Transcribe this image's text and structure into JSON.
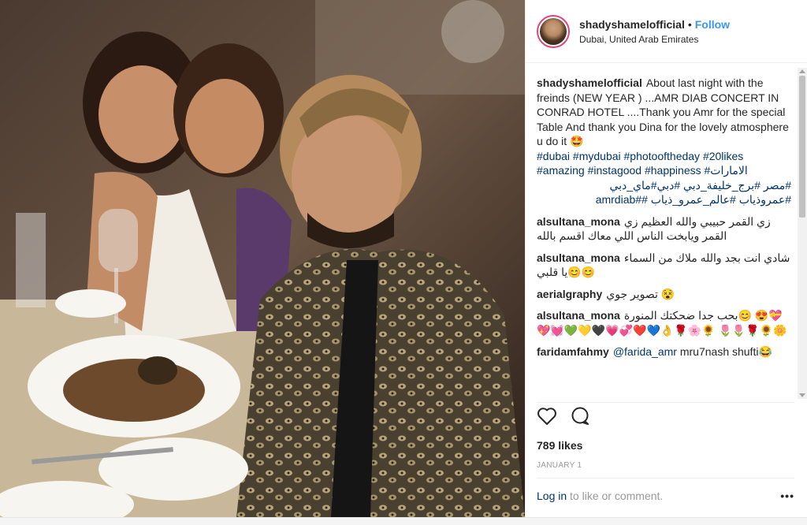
{
  "post": {
    "username": "shadyshamelofficial",
    "separator": "•",
    "follow_label": "Follow",
    "location": "Dubai, United Arab Emirates",
    "caption": {
      "text": "About last night with the freinds (NEW YEAR ) ...AMR DIAB CONCERT IN CONRAD HOTEL ....Thank you Amr for the special Table And thank you Dina for the lovely atmosphere u do it 🤩",
      "hashtags_line1": "#dubai #mydubai #photooftheday #20likes",
      "hashtags_line2": "#amazing #instagood #happiness #الامارات",
      "hashtags_line3": "#مصر #برج_خليفة_دبي #دبي#ماي_دبي",
      "hashtags_line4": "#عمروذياب #عالم_عمرو_ذياب ##amrdiab"
    },
    "comments": [
      {
        "user": "alsultana_mona",
        "text": "زي القمر حبيبي والله العظيم زي القمر ويابخت الناس اللي معاك اقسم بالله"
      },
      {
        "user": "alsultana_mona",
        "text": "شادي انت بجد والله ملاك من السماء يا قلبي😊😊"
      },
      {
        "user": "aerialgraphy",
        "text": "تصوير جوي 😵"
      },
      {
        "user": "alsultana_mona",
        "text": "بحب جدا ضحكتك المنورة😊 😍💝💖💓💚💛🖤💗💞❤️💙👌🌹🌸🌻 🌷🌷🌹🌻🌼"
      },
      {
        "user": "faridamfahmy",
        "mention": "@farida_amr",
        "text": "mru7nash shufti😂"
      }
    ],
    "likes": "789 likes",
    "date": "JANUARY 1",
    "login_link": "Log in",
    "login_suffix": " to like or comment.",
    "more": "•••",
    "icons": {
      "like": "heart-outline-icon",
      "comment": "comment-bubble-icon",
      "more": "ellipsis-icon"
    }
  },
  "colors": {
    "accent": "#3897f0",
    "hashtag": "#003569",
    "muted": "#999999"
  }
}
